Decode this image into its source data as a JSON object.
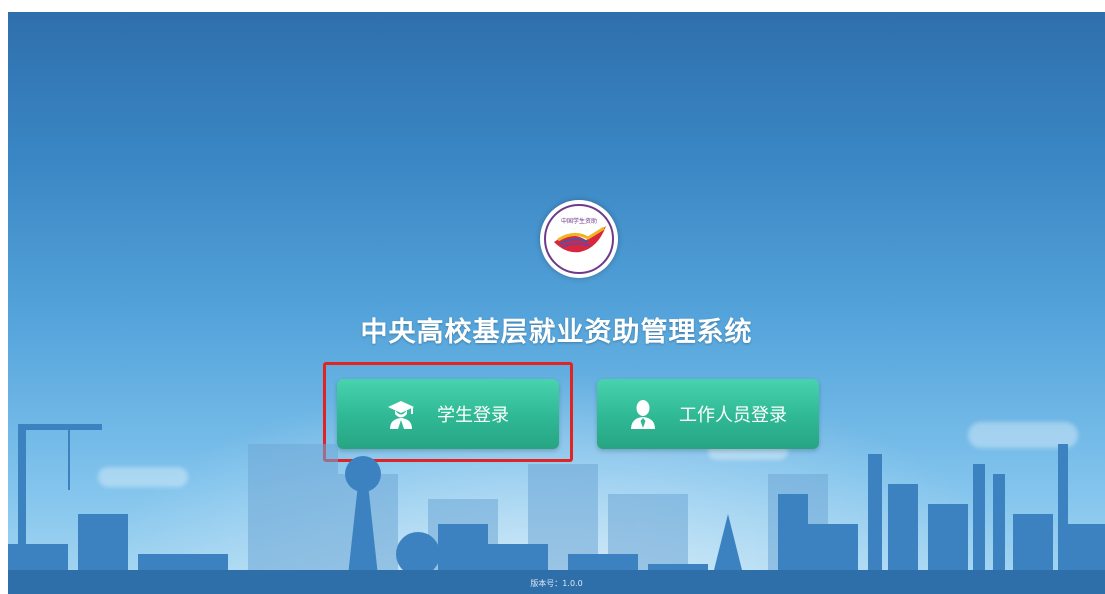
{
  "header": {
    "title": "中央高校基层就业资助管理系统"
  },
  "logo": {
    "text": "中国学生资助"
  },
  "buttons": {
    "student_login": "学生登录",
    "staff_login": "工作人员登录"
  },
  "footer": {
    "version": "版本号：1.0.0"
  },
  "colors": {
    "button": "#2fb894",
    "highlight": "#e02424",
    "sky": "#3a86c4"
  }
}
